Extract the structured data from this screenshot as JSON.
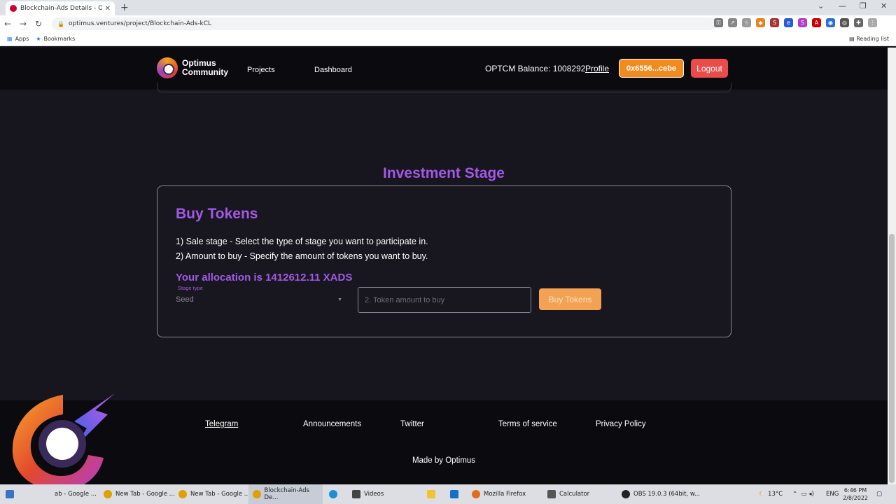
{
  "browser": {
    "tab_title": "Blockchain-Ads Details - Optimus Community",
    "url": "optimus.ventures/project/Blockchain-Ads-kCL",
    "bookmarks": [
      "Apps",
      "Bookmarks"
    ],
    "reading_list": "Reading list"
  },
  "header": {
    "logo_line1": "Optimus",
    "logo_line2": "Community",
    "nav": [
      "Projects",
      "Dashboard"
    ],
    "balance": "OPTCM Balance: 1008292",
    "profile": "Profile",
    "wallet": "0x6556...cebe",
    "logout": "Logout"
  },
  "main": {
    "section_title": "Investment Stage",
    "card_title": "Buy Tokens",
    "instruction1": "1) Sale stage - Select the type of stage you want to participate in.",
    "instruction2": "2) Amount to buy - Specify the amount of tokens you want to buy.",
    "allocation": "Your allocation is 1412612.11 XADS",
    "stage_label": "Stage type",
    "stage_value": "Seed",
    "amount_placeholder": "2. Token amount to buy",
    "buy_button": "Buy Tokens"
  },
  "footer": {
    "links": [
      "Telegram",
      "Announcements",
      "Twitter",
      "Terms of service",
      "Privacy Policy"
    ],
    "made_by": "Made by Optimus"
  },
  "taskbar": {
    "items": [
      "ab - Google ...",
      "New Tab - Google ...",
      "New Tab - Google ...",
      "Blockchain-Ads De...",
      "Videos",
      "Mozilla Firefox",
      "Calculator",
      "OBS 19.0.3 (64bit, w..."
    ],
    "temperature": "13°C",
    "language": "ENG",
    "time": "6:46 PM",
    "date": "2/8/2022"
  },
  "colors": {
    "accent_purple": "#a259e6",
    "wallet_orange": "#f38a1d",
    "logout_red": "#ea4c4c",
    "buy_orange": "#f3a152",
    "background": "#17151d"
  }
}
